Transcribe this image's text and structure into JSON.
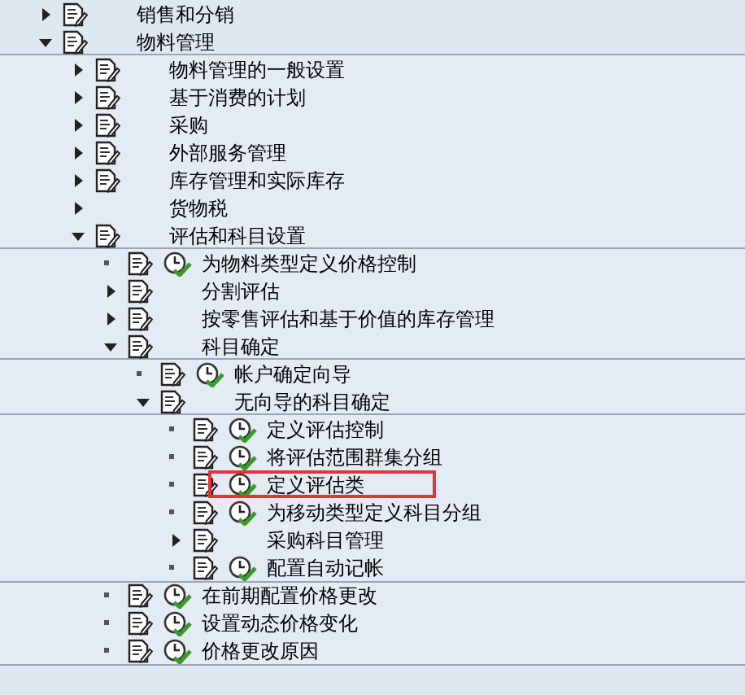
{
  "tree": [
    {
      "kind": "node",
      "label": "销售和分销",
      "expanded": false
    },
    {
      "kind": "node",
      "label": "物料管理",
      "expanded": true,
      "children": [
        {
          "kind": "node",
          "label": "物料管理的一般设置",
          "expanded": false
        },
        {
          "kind": "node",
          "label": "基于消费的计划",
          "expanded": false
        },
        {
          "kind": "node",
          "label": "采购",
          "expanded": false
        },
        {
          "kind": "node",
          "label": "外部服务管理",
          "expanded": false
        },
        {
          "kind": "node",
          "label": "库存管理和实际库存",
          "expanded": false
        },
        {
          "kind": "plain-node",
          "label": "货物税",
          "expanded": false
        },
        {
          "kind": "node",
          "label": "评估和科目设置",
          "expanded": true,
          "children": [
            {
              "kind": "activity",
              "label": "为物料类型定义价格控制"
            },
            {
              "kind": "node",
              "label": "分割评估",
              "expanded": false
            },
            {
              "kind": "node",
              "label": "按零售评估和基于价值的库存管理",
              "expanded": false
            },
            {
              "kind": "node",
              "label": "科目确定",
              "expanded": true,
              "children": [
                {
                  "kind": "activity",
                  "label": "帐户确定向导"
                },
                {
                  "kind": "node",
                  "label": "无向导的科目确定",
                  "expanded": true,
                  "children": [
                    {
                      "kind": "activity",
                      "label": "定义评估控制",
                      "highlighted": false
                    },
                    {
                      "kind": "activity",
                      "label": "将评估范围群集分组",
                      "highlighted": false
                    },
                    {
                      "kind": "activity",
                      "label": "定义评估类",
                      "highlighted": true
                    },
                    {
                      "kind": "activity",
                      "label": "为移动类型定义科目分组",
                      "highlighted": false
                    },
                    {
                      "kind": "node",
                      "label": "采购科目管理",
                      "expanded": false,
                      "highlighted": false
                    },
                    {
                      "kind": "activity",
                      "label": "配置自动记帐",
                      "highlighted": false
                    }
                  ]
                }
              ]
            },
            {
              "kind": "activity",
              "label": "在前期配置价格更改"
            },
            {
              "kind": "activity",
              "label": "设置动态价格变化"
            },
            {
              "kind": "activity",
              "label": "价格更改原因"
            }
          ]
        }
      ]
    }
  ]
}
